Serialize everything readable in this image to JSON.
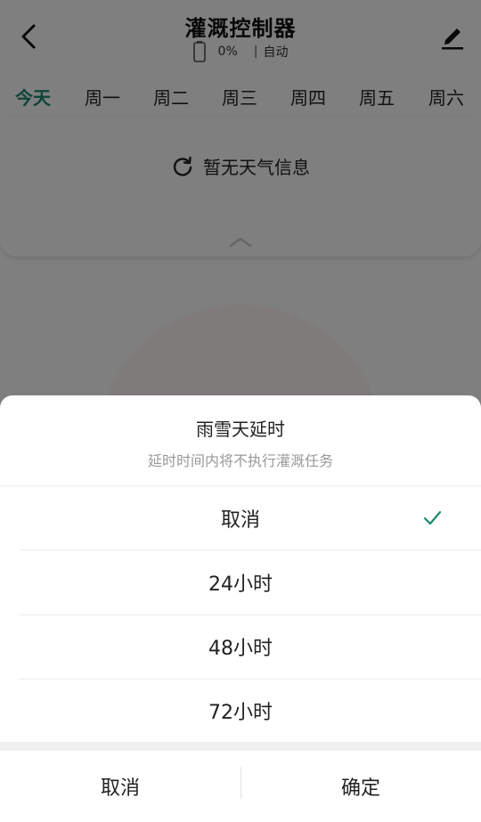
{
  "header": {
    "title": "灌溉控制器",
    "battery_percent": "0%",
    "mode": "自动",
    "separator": "|"
  },
  "days": [
    "今天",
    "周一",
    "周二",
    "周三",
    "周四",
    "周五",
    "周六"
  ],
  "weather": {
    "message": "暂无天气信息"
  },
  "sheet": {
    "title": "雨雪天延时",
    "subtitle": "延时时间内将不执行灌溉任务",
    "options": [
      "取消",
      "24小时",
      "48小时",
      "72小时"
    ],
    "selected_index": 0,
    "cancel_label": "取消",
    "confirm_label": "确定"
  },
  "colors": {
    "accent": "#1a8a6e",
    "overlay": "#000000"
  }
}
